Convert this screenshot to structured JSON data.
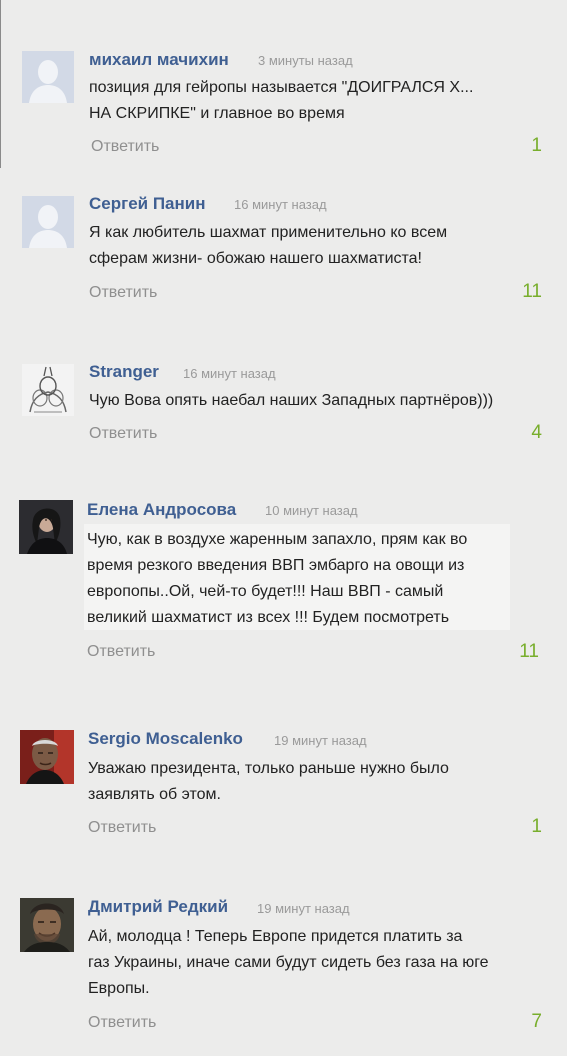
{
  "reply_label": "Ответить",
  "colors": {
    "background": "#ececeb",
    "author": "#3f5f92",
    "votes": "#78ae2c",
    "meta": "#9a9a9a"
  },
  "comments": [
    {
      "author": "михаил мачихин",
      "time": "3 минуты назад",
      "text": "позиция для гейропы называется \"ДОИГРАЛСЯ Х...\nНА СКРИПКЕ\" и главное во время",
      "votes": "1",
      "avatar": "default-avatar-icon"
    },
    {
      "author": "Сергей Панин",
      "time": "16 минут назад",
      "text": "Я как любитель шахмат применительно ко всем\nсферам жизни- обожаю нашего шахматиста!",
      "votes": "11",
      "avatar": "default-avatar-icon"
    },
    {
      "author": "Stranger",
      "time": "16 минут назад",
      "text": "Чую Вова опять наебал наших Западных партнёров)))",
      "votes": "4",
      "avatar": "sketch-avatar"
    },
    {
      "author": "Елена Андросова",
      "time": "10 минут назад",
      "text": "Чую, как в воздухе жаренным запахло, прям как во\nвремя резкого введения ВВП эмбарго на овощи из\nевропопы..Ой, чей-то будет!!! Наш ВВП - самый\nвеликий шахматист из всех !!! Будем посмотреть",
      "votes": "11",
      "avatar": "portrait-avatar"
    },
    {
      "author": "Sergio Moscalenko",
      "time": "19 минут назад",
      "text": "Уважаю президента, только раньше нужно было\nзаявлять об этом.",
      "votes": "1",
      "avatar": "portrait-avatar"
    },
    {
      "author": "Дмитрий Редкий",
      "time": "19 минут назад",
      "text": "Ай, молодца ! Теперь Европе придется платить за\nгаз Украины, иначе сами будут сидеть без газа на юге\nЕвропы.",
      "votes": "7",
      "avatar": "portrait-avatar"
    }
  ]
}
